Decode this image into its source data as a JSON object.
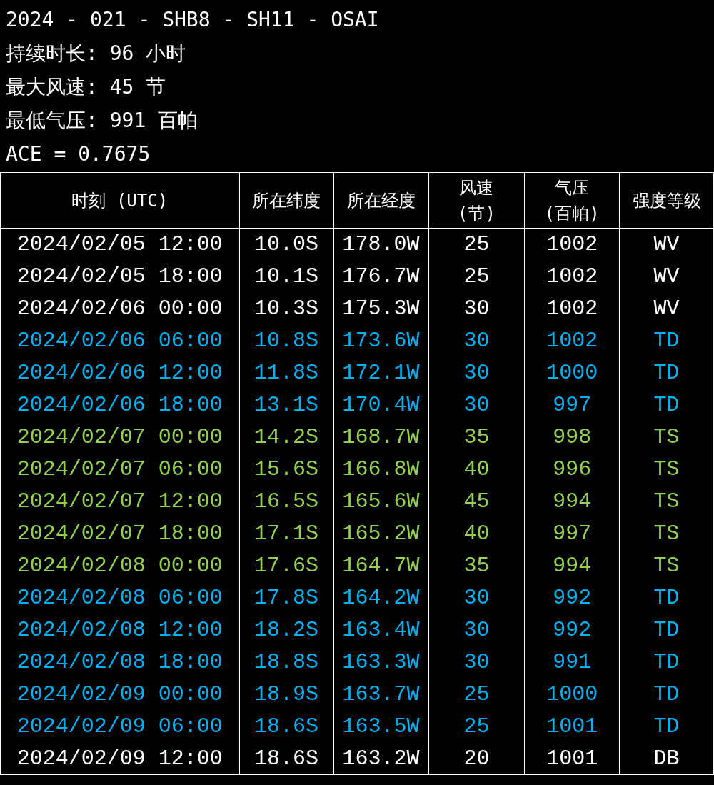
{
  "summary": {
    "title": "2024 - 021 - SHB8 - SH11 - OSAI",
    "lines": [
      "持续时长: 96 小时",
      "最大风速: 45 节",
      "最低气压: 991 百帕",
      "ACE = 0.7675"
    ]
  },
  "table": {
    "columns": [
      "时刻 (UTC)",
      "所在纬度",
      "所在经度",
      "风速\n(节)",
      "气压\n(百帕)",
      "强度等级"
    ],
    "rows": [
      {
        "cells": [
          "2024/02/05 12:00",
          "10.0S",
          "178.0W",
          "25",
          "1002",
          "WV"
        ],
        "color": "#ffffff"
      },
      {
        "cells": [
          "2024/02/05 18:00",
          "10.1S",
          "176.7W",
          "25",
          "1002",
          "WV"
        ],
        "color": "#ffffff"
      },
      {
        "cells": [
          "2024/02/06 00:00",
          "10.3S",
          "175.3W",
          "30",
          "1002",
          "WV"
        ],
        "color": "#ffffff"
      },
      {
        "cells": [
          "2024/02/06 06:00",
          "10.8S",
          "173.6W",
          "30",
          "1002",
          "TD"
        ],
        "color": "#00b0f0"
      },
      {
        "cells": [
          "2024/02/06 12:00",
          "11.8S",
          "172.1W",
          "30",
          "1000",
          "TD"
        ],
        "color": "#00b0f0"
      },
      {
        "cells": [
          "2024/02/06 18:00",
          "13.1S",
          "170.4W",
          "30",
          "997",
          "TD"
        ],
        "color": "#00b0f0"
      },
      {
        "cells": [
          "2024/02/07 00:00",
          "14.2S",
          "168.7W",
          "35",
          "998",
          "TS"
        ],
        "color": "#92d050"
      },
      {
        "cells": [
          "2024/02/07 06:00",
          "15.6S",
          "166.8W",
          "40",
          "996",
          "TS"
        ],
        "color": "#92d050"
      },
      {
        "cells": [
          "2024/02/07 12:00",
          "16.5S",
          "165.6W",
          "45",
          "994",
          "TS"
        ],
        "color": "#92d050"
      },
      {
        "cells": [
          "2024/02/07 18:00",
          "17.1S",
          "165.2W",
          "40",
          "997",
          "TS"
        ],
        "color": "#92d050"
      },
      {
        "cells": [
          "2024/02/08 00:00",
          "17.6S",
          "164.7W",
          "35",
          "994",
          "TS"
        ],
        "color": "#92d050"
      },
      {
        "cells": [
          "2024/02/08 06:00",
          "17.8S",
          "164.2W",
          "30",
          "992",
          "TD"
        ],
        "color": "#00b0f0"
      },
      {
        "cells": [
          "2024/02/08 12:00",
          "18.2S",
          "163.4W",
          "30",
          "992",
          "TD"
        ],
        "color": "#00b0f0"
      },
      {
        "cells": [
          "2024/02/08 18:00",
          "18.8S",
          "163.3W",
          "30",
          "991",
          "TD"
        ],
        "color": "#00b0f0"
      },
      {
        "cells": [
          "2024/02/09 00:00",
          "18.9S",
          "163.7W",
          "25",
          "1000",
          "TD"
        ],
        "color": "#00b0f0"
      },
      {
        "cells": [
          "2024/02/09 06:00",
          "18.6S",
          "163.5W",
          "25",
          "1001",
          "TD"
        ],
        "color": "#00b0f0"
      },
      {
        "cells": [
          "2024/02/09 12:00",
          "18.6S",
          "163.2W",
          "20",
          "1001",
          "DB"
        ],
        "color": "#ffffff"
      }
    ]
  }
}
